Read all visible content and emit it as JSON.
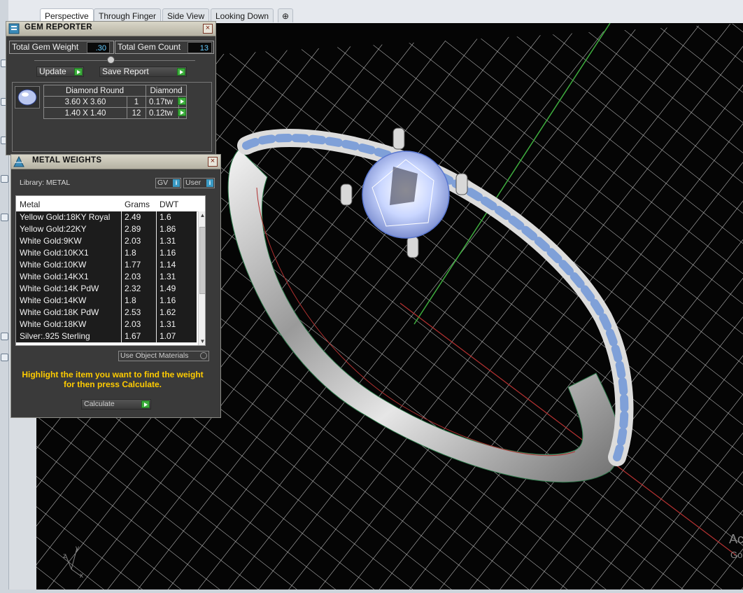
{
  "tabs": [
    {
      "label": "Perspective",
      "active": true
    },
    {
      "label": "Through Finger",
      "active": false
    },
    {
      "label": "Side View",
      "active": false
    },
    {
      "label": "Looking Down",
      "active": false
    }
  ],
  "add_tab_icon": "plus-icon",
  "gem_reporter": {
    "title": "GEM REPORTER",
    "close": "×",
    "total_weight_label": "Total Gem Weight",
    "total_weight_value": ".30",
    "total_count_label": "Total Gem Count",
    "total_count_value": "13",
    "update_label": "Update",
    "save_report_label": "Save Report",
    "table_headers": {
      "shape": "Diamond Round",
      "material": "Diamond"
    },
    "rows": [
      {
        "size": "3.60 X 3.60",
        "count": "1",
        "weight": "0.17tw"
      },
      {
        "size": "1.40 X 1.40",
        "count": "12",
        "weight": "0.12tw"
      }
    ]
  },
  "metal_weights": {
    "title": "METAL WEIGHTS",
    "close": "×",
    "library_label": "Library: METAL",
    "gv_label": "GV",
    "user_label": "User",
    "info_icon": "i",
    "columns": [
      "Metal",
      "Grams",
      "DWT"
    ],
    "rows": [
      {
        "metal": "Yellow Gold:18KY Royal",
        "grams": "2.49",
        "dwt": "1.6"
      },
      {
        "metal": "Yellow Gold:22KY",
        "grams": "2.89",
        "dwt": "1.86"
      },
      {
        "metal": "White Gold:9KW",
        "grams": "2.03",
        "dwt": "1.31"
      },
      {
        "metal": "White Gold:10KX1",
        "grams": "1.8",
        "dwt": "1.16"
      },
      {
        "metal": "White Gold:10KW",
        "grams": "1.77",
        "dwt": "1.14"
      },
      {
        "metal": "White Gold:14KX1",
        "grams": "2.03",
        "dwt": "1.31"
      },
      {
        "metal": "White Gold:14K PdW",
        "grams": "2.32",
        "dwt": "1.49"
      },
      {
        "metal": "White Gold:14KW",
        "grams": "1.8",
        "dwt": "1.16"
      },
      {
        "metal": "White Gold:18K PdW",
        "grams": "2.53",
        "dwt": "1.62"
      },
      {
        "metal": "White Gold:18KW",
        "grams": "2.03",
        "dwt": "1.31"
      },
      {
        "metal": "Silver:.925 Sterling",
        "grams": "1.67",
        "dwt": "1.07"
      }
    ],
    "use_object_materials_label": "Use Object Materials",
    "hint": "Highlight the item you want to find the weight for then press Calculate.",
    "calculate_label": "Calculate"
  },
  "viewport": {
    "axis_y": "y",
    "axis_z": "z",
    "axis_x": "x",
    "watermark_line1": "Ac",
    "watermark_line2": "Go"
  },
  "colors": {
    "panel_bg": "#3a3a3a",
    "accent_green": "#3cad3c",
    "hint_yellow": "#ffcc00",
    "field_blue": "#66ccff"
  }
}
